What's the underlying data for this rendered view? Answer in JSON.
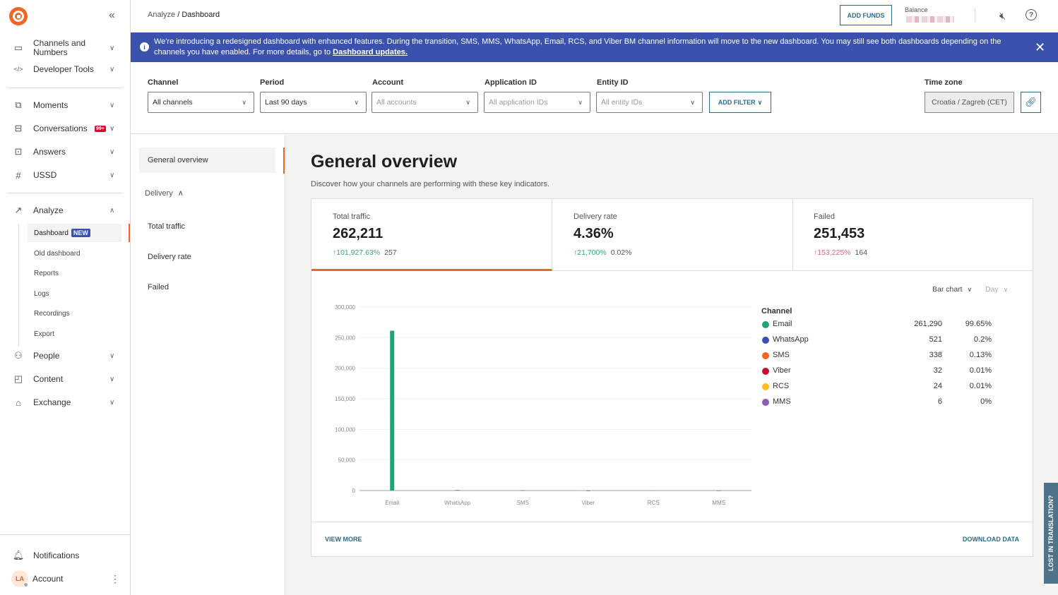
{
  "sidebar": {
    "collapse_icon": "double-chevron-left-icon",
    "items": [
      {
        "label": "Channels and Numbers",
        "icon": "chat-icon"
      },
      {
        "label": "Developer Tools",
        "icon": "code-icon"
      },
      {
        "label": "Moments",
        "icon": "moments-icon"
      },
      {
        "label": "Conversations",
        "icon": "conversations-icon",
        "badge": "99+"
      },
      {
        "label": "Answers",
        "icon": "bot-icon"
      },
      {
        "label": "USSD",
        "icon": "ussd-icon"
      },
      {
        "label": "Analyze",
        "icon": "analytics-icon"
      },
      {
        "label": "People",
        "icon": "people-icon"
      },
      {
        "label": "Content",
        "icon": "content-icon"
      },
      {
        "label": "Exchange",
        "icon": "exchange-icon"
      }
    ],
    "analyze_sub": [
      {
        "label": "Dashboard",
        "badge": "NEW"
      },
      {
        "label": "Old dashboard"
      },
      {
        "label": "Reports"
      },
      {
        "label": "Logs"
      },
      {
        "label": "Recordings"
      },
      {
        "label": "Export"
      }
    ],
    "notifications": "Notifications",
    "account": {
      "label": "Account",
      "initials": "LA"
    }
  },
  "topbar": {
    "breadcrumb_parent": "Analyze",
    "breadcrumb_sep": " / ",
    "breadcrumb_current": "Dashboard",
    "add_funds": "ADD FUNDS",
    "balance_label": "Balance"
  },
  "banner": {
    "text": "We're introducing a redesigned dashboard with enhanced features. During the transition, SMS, MMS, WhatsApp, Email, RCS, and Viber BM channel information will move to the new dashboard. You may still see both dashboards depending on the channels you have enabled. For more details, go to ",
    "link": "Dashboard updates."
  },
  "filters": {
    "channel": {
      "label": "Channel",
      "value": "All channels"
    },
    "period": {
      "label": "Period",
      "value": "Last 90 days"
    },
    "account": {
      "label": "Account",
      "placeholder": "All accounts"
    },
    "application_id": {
      "label": "Application ID",
      "placeholder": "All application IDs"
    },
    "entity_id": {
      "label": "Entity ID",
      "placeholder": "All entity IDs"
    },
    "add_filter": "ADD FILTER",
    "timezone": {
      "label": "Time zone",
      "value": "Croatia / Zagreb (CET)"
    }
  },
  "section_nav": {
    "general": "General overview",
    "group": "Delivery",
    "items": [
      "Total traffic",
      "Delivery rate",
      "Failed"
    ]
  },
  "main": {
    "title": "General overview",
    "subtitle": "Discover how your channels are performing with these key indicators.",
    "kpis": [
      {
        "title": "Total traffic",
        "value": "262,211",
        "change": "↑101,927.63%",
        "prev": "257",
        "trend": "positive"
      },
      {
        "title": "Delivery rate",
        "value": "4.36%",
        "change": "↑21,700%",
        "prev": "0.02%",
        "trend": "positive"
      },
      {
        "title": "Failed",
        "value": "251,453",
        "change": "↑153,225%",
        "prev": "164",
        "trend": "negative"
      }
    ],
    "chart_type": "Bar chart",
    "granularity": "Day",
    "view_more": "VIEW MORE",
    "download": "DOWNLOAD DATA"
  },
  "chart_data": {
    "type": "bar",
    "title": "",
    "xlabel": "",
    "ylabel": "",
    "categories": [
      "Email",
      "WhatsApp",
      "SMS",
      "Viber",
      "RCS",
      "MMS"
    ],
    "values": [
      261290,
      521,
      338,
      32,
      24,
      6
    ],
    "ylim": [
      0,
      300000
    ],
    "yticks": [
      0,
      50000,
      100000,
      150000,
      200000,
      250000,
      300000
    ],
    "ytick_labels": [
      "0",
      "50,000",
      "100,000",
      "150,000",
      "200,000",
      "250,000",
      "300,000"
    ],
    "grid": true,
    "legend": {
      "title": "Channel",
      "placement": "right",
      "entries": [
        {
          "name": "Email",
          "count": "261,290",
          "percent": "99.65%",
          "color": "#1fa574"
        },
        {
          "name": "WhatsApp",
          "count": "521",
          "percent": "0.2%",
          "color": "#3a4fb0"
        },
        {
          "name": "SMS",
          "count": "338",
          "percent": "0.13%",
          "color": "#f26522"
        },
        {
          "name": "Viber",
          "count": "32",
          "percent": "0.01%",
          "color": "#c8102e"
        },
        {
          "name": "RCS",
          "count": "24",
          "percent": "0.01%",
          "color": "#fbbf24"
        },
        {
          "name": "MMS",
          "count": "6",
          "percent": "0%",
          "color": "#8b5cb8"
        }
      ]
    }
  },
  "feedback_tab": "LOST IN TRANSLATION?",
  "colors": {
    "accent": "#f26522",
    "primary": "#2c6b8a",
    "banner": "#3a52ad"
  }
}
